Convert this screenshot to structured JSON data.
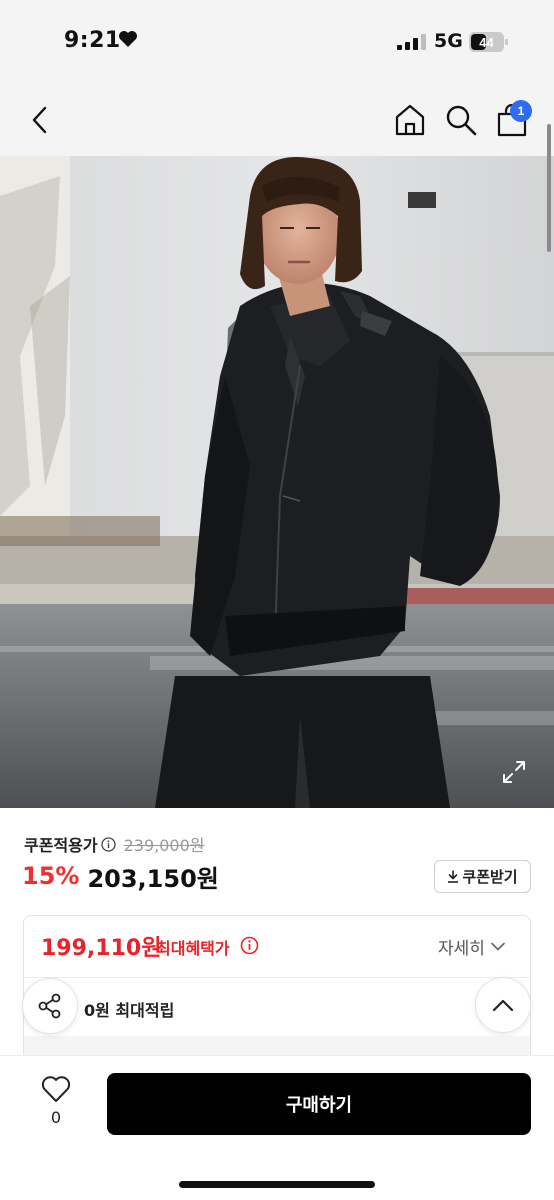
{
  "status_bar": {
    "time": "9:21",
    "network": "5G",
    "battery": "44",
    "heart_icon": "heart-icon"
  },
  "nav": {
    "back_icon": "chevron-left-icon",
    "home_icon": "home-icon",
    "search_icon": "search-icon",
    "cart_icon": "cart-icon",
    "cart_count": "1",
    "badge_color": "#2f6cf5"
  },
  "product": {
    "image_icon": "product-photo",
    "expand_icon": "expand-icon"
  },
  "pricing": {
    "coupon_label": "쿠폰적용가",
    "original_price": "239,000원",
    "discount": "15%",
    "sale_price": "203,150원",
    "coupon_button": "쿠폰받기",
    "accent_color": "#f03030"
  },
  "benefit": {
    "max_price": "199,110원",
    "max_label": "최대혜택가",
    "detail_link": "자세히",
    "points_text": "0원 최대적립"
  },
  "actions": {
    "share_icon": "share-icon",
    "top_icon": "chevron-up-icon"
  },
  "bottom_bar": {
    "like_icon": "heart-outline-icon",
    "like_count": "0",
    "buy_label": "구매하기"
  }
}
